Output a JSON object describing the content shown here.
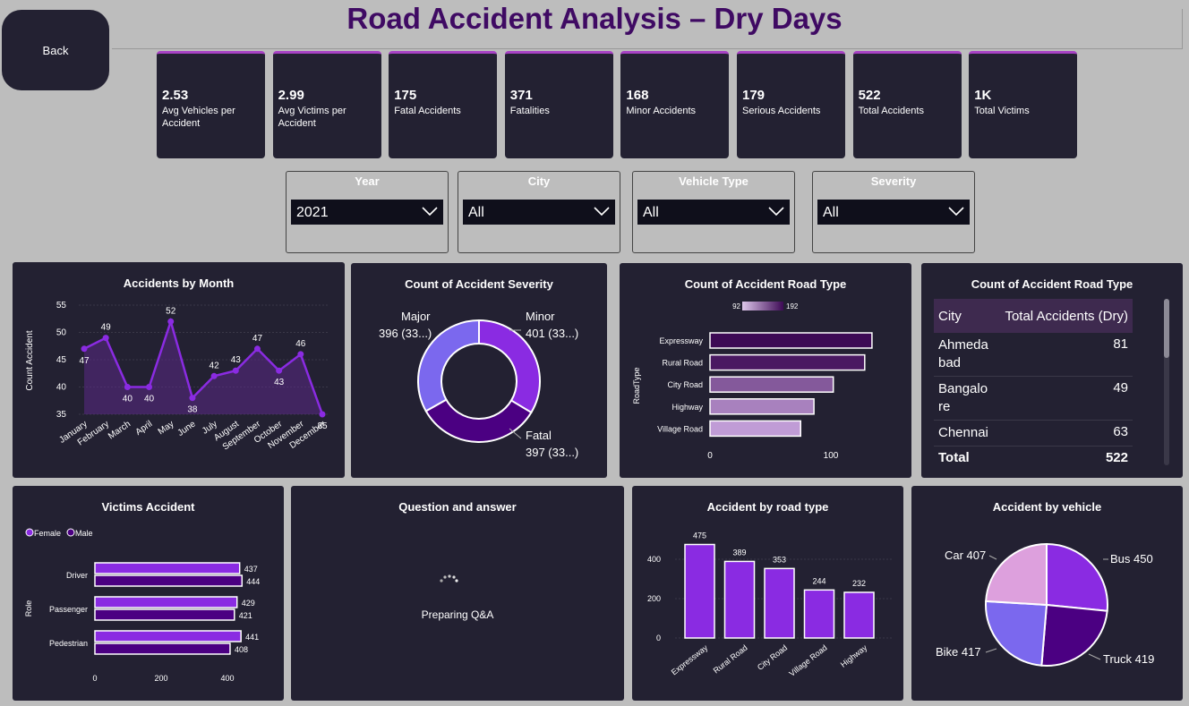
{
  "header": {
    "title": "Road Accident Analysis – Dry Days",
    "back_label": "Back"
  },
  "kpis": [
    {
      "value": "2.53",
      "label": "Avg Vehicles per Accident"
    },
    {
      "value": "2.99",
      "label": "Avg Victims per Accident"
    },
    {
      "value": "175",
      "label": "Fatal Accidents"
    },
    {
      "value": "371",
      "label": "Fatalities"
    },
    {
      "value": "168",
      "label": "Minor Accidents"
    },
    {
      "value": "179",
      "label": "Serious Accidents"
    },
    {
      "value": "522",
      "label": "Total Accidents"
    },
    {
      "value": "1K",
      "label": "Total Victims"
    }
  ],
  "filters": [
    {
      "label": "Year",
      "selected": "2021"
    },
    {
      "label": "City",
      "selected": "All"
    },
    {
      "label": "Vehicle Type",
      "selected": "All"
    },
    {
      "label": "Severity",
      "selected": "All"
    }
  ],
  "colors": {
    "accent": "#8a2be2",
    "card_bg": "#232132",
    "page_bg": "#bdbdbd",
    "title": "#3f0a63"
  },
  "month_chart": {
    "title": "Accidents by Month",
    "ylabel": "Count Accident",
    "yticks": [
      "55",
      "50",
      "45",
      "40",
      "35"
    ],
    "point_labels": [
      "47",
      "49",
      "40",
      "40",
      "52",
      "38",
      "42",
      "43",
      "47",
      "43",
      "46",
      "35"
    ],
    "months": [
      "January",
      "February",
      "March",
      "April",
      "May",
      "June",
      "July",
      "August",
      "September",
      "October",
      "November",
      "December"
    ]
  },
  "severity_chart": {
    "title": "Count of Accident Severity",
    "labels": [
      {
        "name": "Major",
        "value": "396 (33...)"
      },
      {
        "name": "Minor",
        "value": "401 (33...)"
      },
      {
        "name": "Fatal",
        "value": "397 (33...)"
      }
    ]
  },
  "roadtype_chart": {
    "title": "Count of Accident Road Type",
    "ylabel": "RoadType",
    "legend_min": "92",
    "legend_max": "192",
    "categories": [
      "Expressway",
      "Rural Road",
      "City Road",
      "Highway",
      "Village Road"
    ],
    "xticks": [
      "0",
      "100"
    ]
  },
  "city_table": {
    "title": "Count of Accident Road Type",
    "columns": [
      "City",
      "Total Accidents (Dry)"
    ],
    "rows": [
      {
        "city": "Ahmeda bad",
        "value": "81"
      },
      {
        "city": "Bangalo re",
        "value": "49"
      },
      {
        "city": "Chennai",
        "value": "63"
      }
    ],
    "total_label": "Total",
    "total_value": "522"
  },
  "victims_chart": {
    "title": "Victims Accident",
    "legend": [
      "Female",
      "Male"
    ],
    "ylabel": "Role",
    "roles": [
      "Driver",
      "Passenger",
      "Pedestrian"
    ],
    "value_labels": [
      [
        "437",
        "444"
      ],
      [
        "429",
        "421"
      ],
      [
        "441",
        "408"
      ]
    ],
    "xticks": [
      "0",
      "200",
      "400"
    ]
  },
  "qa": {
    "title": "Question and answer",
    "status": "Preparing Q&A"
  },
  "roadtype_bar": {
    "title": "Accident by road type",
    "categories": [
      "Expressway",
      "Rural Road",
      "City Road",
      "Village Road",
      "Highway"
    ],
    "value_labels": [
      "475",
      "389",
      "353",
      "244",
      "232"
    ],
    "yticks": [
      "400",
      "200",
      "0"
    ]
  },
  "vehicle_pie": {
    "title": "Accident by vehicle",
    "labels": [
      "Bus 450",
      "Truck 419",
      "Bike 417",
      "Car 407"
    ]
  },
  "chart_data": [
    {
      "type": "line",
      "title": "Accidents by Month",
      "ylabel": "Count Accident",
      "categories": [
        "January",
        "February",
        "March",
        "April",
        "May",
        "June",
        "July",
        "August",
        "September",
        "October",
        "November",
        "December"
      ],
      "values": [
        47,
        49,
        40,
        40,
        52,
        38,
        42,
        43,
        47,
        43,
        46,
        35
      ],
      "ylim": [
        35,
        55
      ],
      "color": "#8a2be2"
    },
    {
      "type": "pie",
      "title": "Count of Accident Severity",
      "categories": [
        "Minor",
        "Fatal",
        "Major"
      ],
      "values": [
        401,
        397,
        396
      ],
      "colors": [
        "#8a2be2",
        "#4b0082",
        "#7b68ee"
      ]
    },
    {
      "type": "bar",
      "title": "Count of Accident Road Type",
      "ylabel": "RoadType",
      "categories": [
        "Expressway",
        "Rural Road",
        "City Road",
        "Highway",
        "Village Road"
      ],
      "values": [
        134,
        128,
        102,
        86,
        75
      ],
      "legend": [
        "92",
        "192"
      ]
    },
    {
      "type": "table",
      "title": "Count of Accident Road Type",
      "columns": [
        "City",
        "Total Accidents (Dry)"
      ],
      "rows": [
        [
          "Ahmedabad",
          81
        ],
        [
          "Bangalore",
          49
        ],
        [
          "Chennai",
          63
        ]
      ],
      "total": 522
    },
    {
      "type": "bar",
      "title": "Victims Accident",
      "ylabel": "Role",
      "categories": [
        "Driver",
        "Passenger",
        "Pedestrian"
      ],
      "series": [
        {
          "name": "Female",
          "values": [
            437,
            429,
            441
          ],
          "color": "#8a2be2"
        },
        {
          "name": "Male",
          "values": [
            444,
            421,
            408
          ],
          "color": "#4b0082"
        }
      ],
      "xlim": [
        0,
        450
      ]
    },
    {
      "type": "bar",
      "title": "Accident by road type",
      "categories": [
        "Expressway",
        "Rural Road",
        "City Road",
        "Village Road",
        "Highway"
      ],
      "values": [
        475,
        389,
        353,
        244,
        232
      ],
      "ylim": [
        0,
        500
      ],
      "color": "#8a2be2"
    },
    {
      "type": "pie",
      "title": "Accident by vehicle",
      "categories": [
        "Bus",
        "Truck",
        "Bike",
        "Car"
      ],
      "values": [
        450,
        419,
        417,
        407
      ],
      "colors": [
        "#8a2be2",
        "#4b0082",
        "#7b68ee",
        "#dda0dd"
      ]
    }
  ]
}
